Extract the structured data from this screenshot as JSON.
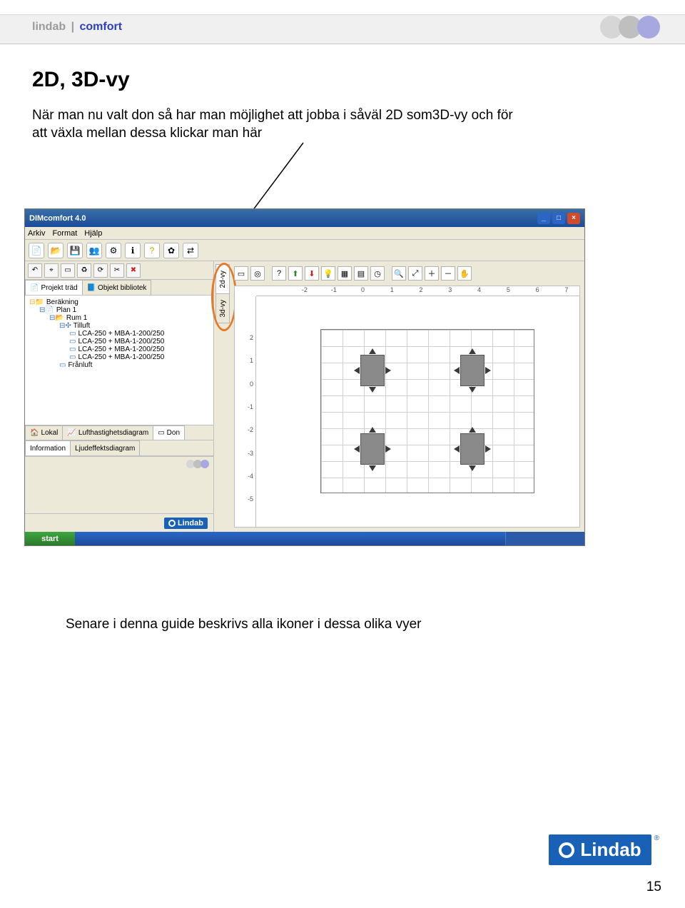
{
  "header": {
    "brand_grey": "lindab",
    "separator": "|",
    "brand_blue": "comfort"
  },
  "title": "2D, 3D-vy",
  "paragraph": "När man nu valt don så har man möjlighet att jobba i såväl 2D som3D-vy och för att växla mellan dessa klickar man här",
  "paragraph2": "Senare i denna guide beskrivs alla ikoner i dessa olika vyer",
  "page_number": "15",
  "logo_text": "Lindab",
  "app": {
    "window_title": "DIMcomfort 4.0",
    "menus": [
      "Arkiv",
      "Format",
      "Hjälp"
    ],
    "left_tabs": [
      "Projekt träd",
      "Objekt  bibliotek"
    ],
    "lower_tabs_row1": [
      "Lokal",
      "Lufthastighetsdiagram",
      "Don"
    ],
    "lower_tabs_row2": [
      "Information",
      "Ljudeffektsdiagram"
    ],
    "view_tabs": [
      "2d-vy",
      "3d-vy"
    ],
    "tree": {
      "root": "Beräkning",
      "plan": "Plan 1",
      "room": "Rum 1",
      "tilluft": "Tilluft",
      "items": [
        "LCA-250 + MBA-1-200/250",
        "LCA-250 + MBA-1-200/250",
        "LCA-250 + MBA-1-200/250",
        "LCA-250 + MBA-1-200/250"
      ],
      "franluft": "Frånluft"
    },
    "ruler_h": [
      "-2",
      "-1",
      "0",
      "1",
      "2",
      "3",
      "4",
      "5",
      "6",
      "7"
    ],
    "ruler_v": [
      "2",
      "1",
      "0",
      "-1",
      "-2",
      "-3",
      "-4",
      "-5"
    ],
    "start_label": "start",
    "canvas_toolbar_icons": [
      "square",
      "target",
      "question",
      "arrows-up",
      "arrows-down",
      "bulb",
      "grid",
      "grid2",
      "clock",
      "zoom-area",
      "zoom-in",
      "zoom-plus",
      "zoom-minus",
      "hand"
    ],
    "main_toolbar_icons": [
      "file",
      "open",
      "save",
      "users",
      "gear",
      "info",
      "help",
      "stamp",
      "swap"
    ],
    "mini_toolbar_icons": [
      "undo",
      "ref",
      "square",
      "recycle",
      "refresh",
      "cut",
      "del"
    ]
  }
}
